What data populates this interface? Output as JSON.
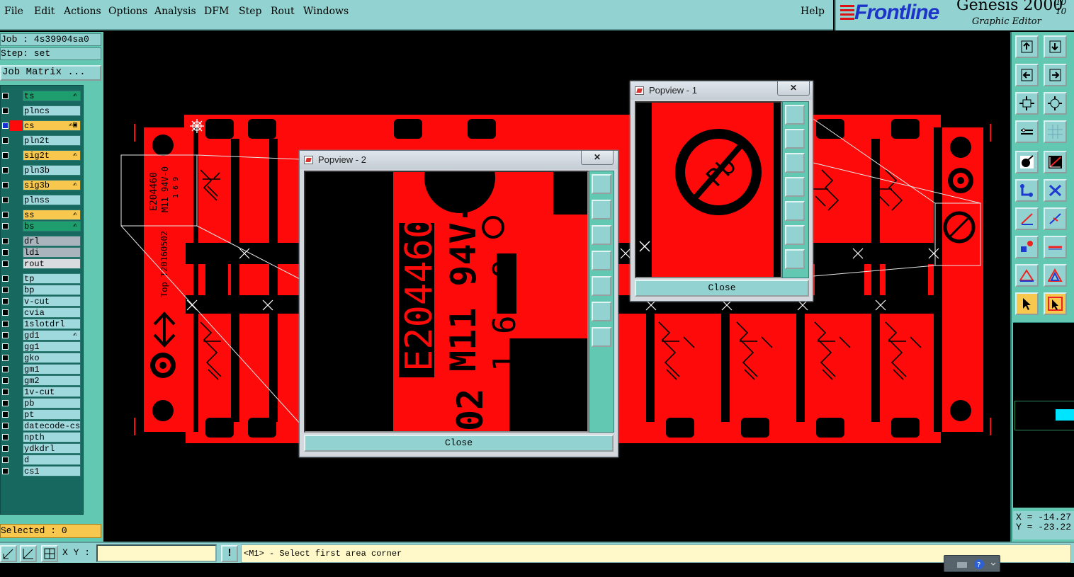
{
  "menubar": {
    "items": [
      "File",
      "Edit",
      "Actions",
      "Options",
      "Analysis",
      "DFM",
      "Step",
      "Rout",
      "Windows"
    ],
    "help": "Help"
  },
  "brand": {
    "logo": "Frontline",
    "product": "Genesis 2000",
    "subtitle": "Graphic Editor",
    "version_line1": "10",
    "version_line2": "10"
  },
  "left": {
    "job": "Job : 4s39904sa0",
    "step": "Step: set",
    "job_matrix": "Job Matrix ...",
    "selected": "Selected : 0"
  },
  "layers": [
    {
      "name": "ts",
      "color": "#1e9e6e",
      "mark": "✍",
      "box": "#000"
    },
    {
      "name": "plncs",
      "color": "#9fd9de",
      "mark": "",
      "box": "#000"
    },
    {
      "name": "cs",
      "color": "#f7c84d",
      "mark": "✍▣",
      "box": "#1b2dd0",
      "active": true
    },
    {
      "name": "pln2t",
      "color": "#9fd9de",
      "mark": "",
      "box": "#000"
    },
    {
      "name": "sig2t",
      "color": "#f7c84d",
      "mark": "✍",
      "box": "#000"
    },
    {
      "name": "pln3b",
      "color": "#9fd9de",
      "mark": "",
      "box": "#000"
    },
    {
      "name": "sig3b",
      "color": "#f7c84d",
      "mark": "✍",
      "box": "#000"
    },
    {
      "name": "plnss",
      "color": "#9fd9de",
      "mark": "",
      "box": "#000"
    },
    {
      "name": "ss",
      "color": "#f7c84d",
      "mark": "✍",
      "box": "#000"
    },
    {
      "name": "bs",
      "color": "#1e9e6e",
      "mark": "✍",
      "box": "#000"
    },
    {
      "name": "drl",
      "color": "#a9b4bd",
      "mark": "",
      "box": "#000"
    },
    {
      "name": "ldi",
      "color": "#a9b4bd",
      "mark": "",
      "box": "#000"
    },
    {
      "name": "rout",
      "color": "#d8dcdf",
      "mark": "",
      "box": "#000"
    },
    {
      "name": "tp",
      "color": "#9fd9de",
      "mark": "",
      "box": "#000"
    },
    {
      "name": "bp",
      "color": "#9fd9de",
      "mark": "",
      "box": "#000"
    },
    {
      "name": "v-cut",
      "color": "#9fd9de",
      "mark": "",
      "box": "#000"
    },
    {
      "name": "cvia",
      "color": "#9fd9de",
      "mark": "",
      "box": "#000"
    },
    {
      "name": "1slotdrl",
      "color": "#9fd9de",
      "mark": "",
      "box": "#000"
    },
    {
      "name": "gd1",
      "color": "#9fd9de",
      "mark": "✍",
      "box": "#000"
    },
    {
      "name": "gg1",
      "color": "#9fd9de",
      "mark": "",
      "box": "#000"
    },
    {
      "name": "gko",
      "color": "#9fd9de",
      "mark": "",
      "box": "#000"
    },
    {
      "name": "gm1",
      "color": "#9fd9de",
      "mark": "",
      "box": "#000"
    },
    {
      "name": "gm2",
      "color": "#9fd9de",
      "mark": "",
      "box": "#000"
    },
    {
      "name": "1v-cut",
      "color": "#9fd9de",
      "mark": "",
      "box": "#000"
    },
    {
      "name": "pb",
      "color": "#9fd9de",
      "mark": "",
      "box": "#000"
    },
    {
      "name": "pt",
      "color": "#9fd9de",
      "mark": "",
      "box": "#000"
    },
    {
      "name": "datecode-cs",
      "color": "#9fd9de",
      "mark": "",
      "box": "#000"
    },
    {
      "name": "npth",
      "color": "#9fd9de",
      "mark": "",
      "box": "#000"
    },
    {
      "name": "ydkdrl",
      "color": "#9fd9de",
      "mark": "",
      "box": "#000"
    },
    {
      "name": "d",
      "color": "#9fd9de",
      "mark": "",
      "box": "#000"
    },
    {
      "name": "cs1",
      "color": "#9fd9de",
      "mark": "",
      "box": "#000"
    }
  ],
  "board": {
    "mark1": "E204460",
    "mark2": "M11 94V-0",
    "mark3": "1 6 9",
    "side_text": "Top T20160502"
  },
  "popview2": {
    "title": "Popview - 2",
    "close": "Close",
    "line1": "E204460",
    "line2": "M11 94V-0",
    "line3": "1 6: 9",
    "line4": "02"
  },
  "popview1": {
    "title": "Popview - 1",
    "close": "Close",
    "symbol": "Pb"
  },
  "coords": {
    "x": "X = -14.27",
    "y": "Y = -23.22"
  },
  "status": {
    "xy_label": "X Y :",
    "xy_value": "",
    "excl": "!",
    "message": "<M1> - Select first area corner"
  },
  "colors": {
    "copper": "#ff0a0a",
    "ui": "#92d3d1",
    "panel": "#62c8b2"
  }
}
